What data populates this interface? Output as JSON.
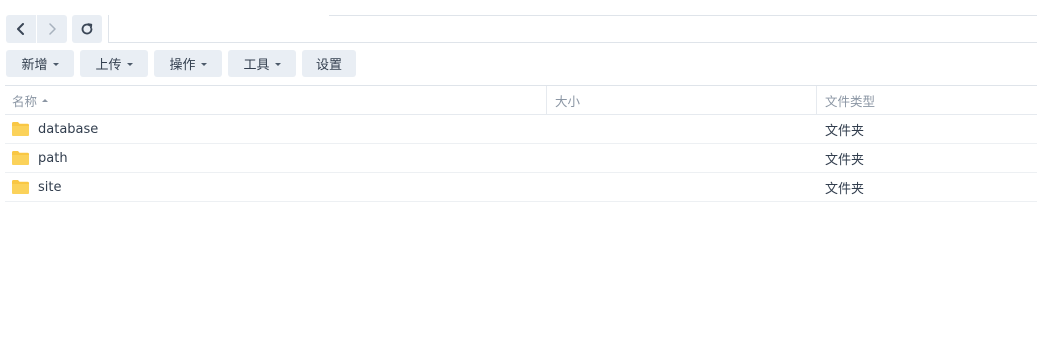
{
  "nav": {
    "back_icon": "chevron-left-icon",
    "forward_icon": "chevron-right-icon",
    "refresh_icon": "refresh-icon"
  },
  "path": {
    "value": ""
  },
  "toolbar": {
    "new_label": "新增",
    "upload_label": "上传",
    "action_label": "操作",
    "tools_label": "工具",
    "settings_label": "设置"
  },
  "grid": {
    "columns": {
      "name": "名称",
      "size": "大小",
      "type": "文件类型"
    },
    "rows": [
      {
        "name": "database",
        "size": "",
        "type": "文件夹",
        "icon": "folder-icon"
      },
      {
        "name": "path",
        "size": "",
        "type": "文件夹",
        "icon": "folder-icon"
      },
      {
        "name": "site",
        "size": "",
        "type": "文件夹",
        "icon": "folder-icon"
      }
    ]
  },
  "colors": {
    "button_bg": "#e9eef4",
    "folder": "#f9c744",
    "text": "#323e4e",
    "header_text": "#8b96a4"
  }
}
